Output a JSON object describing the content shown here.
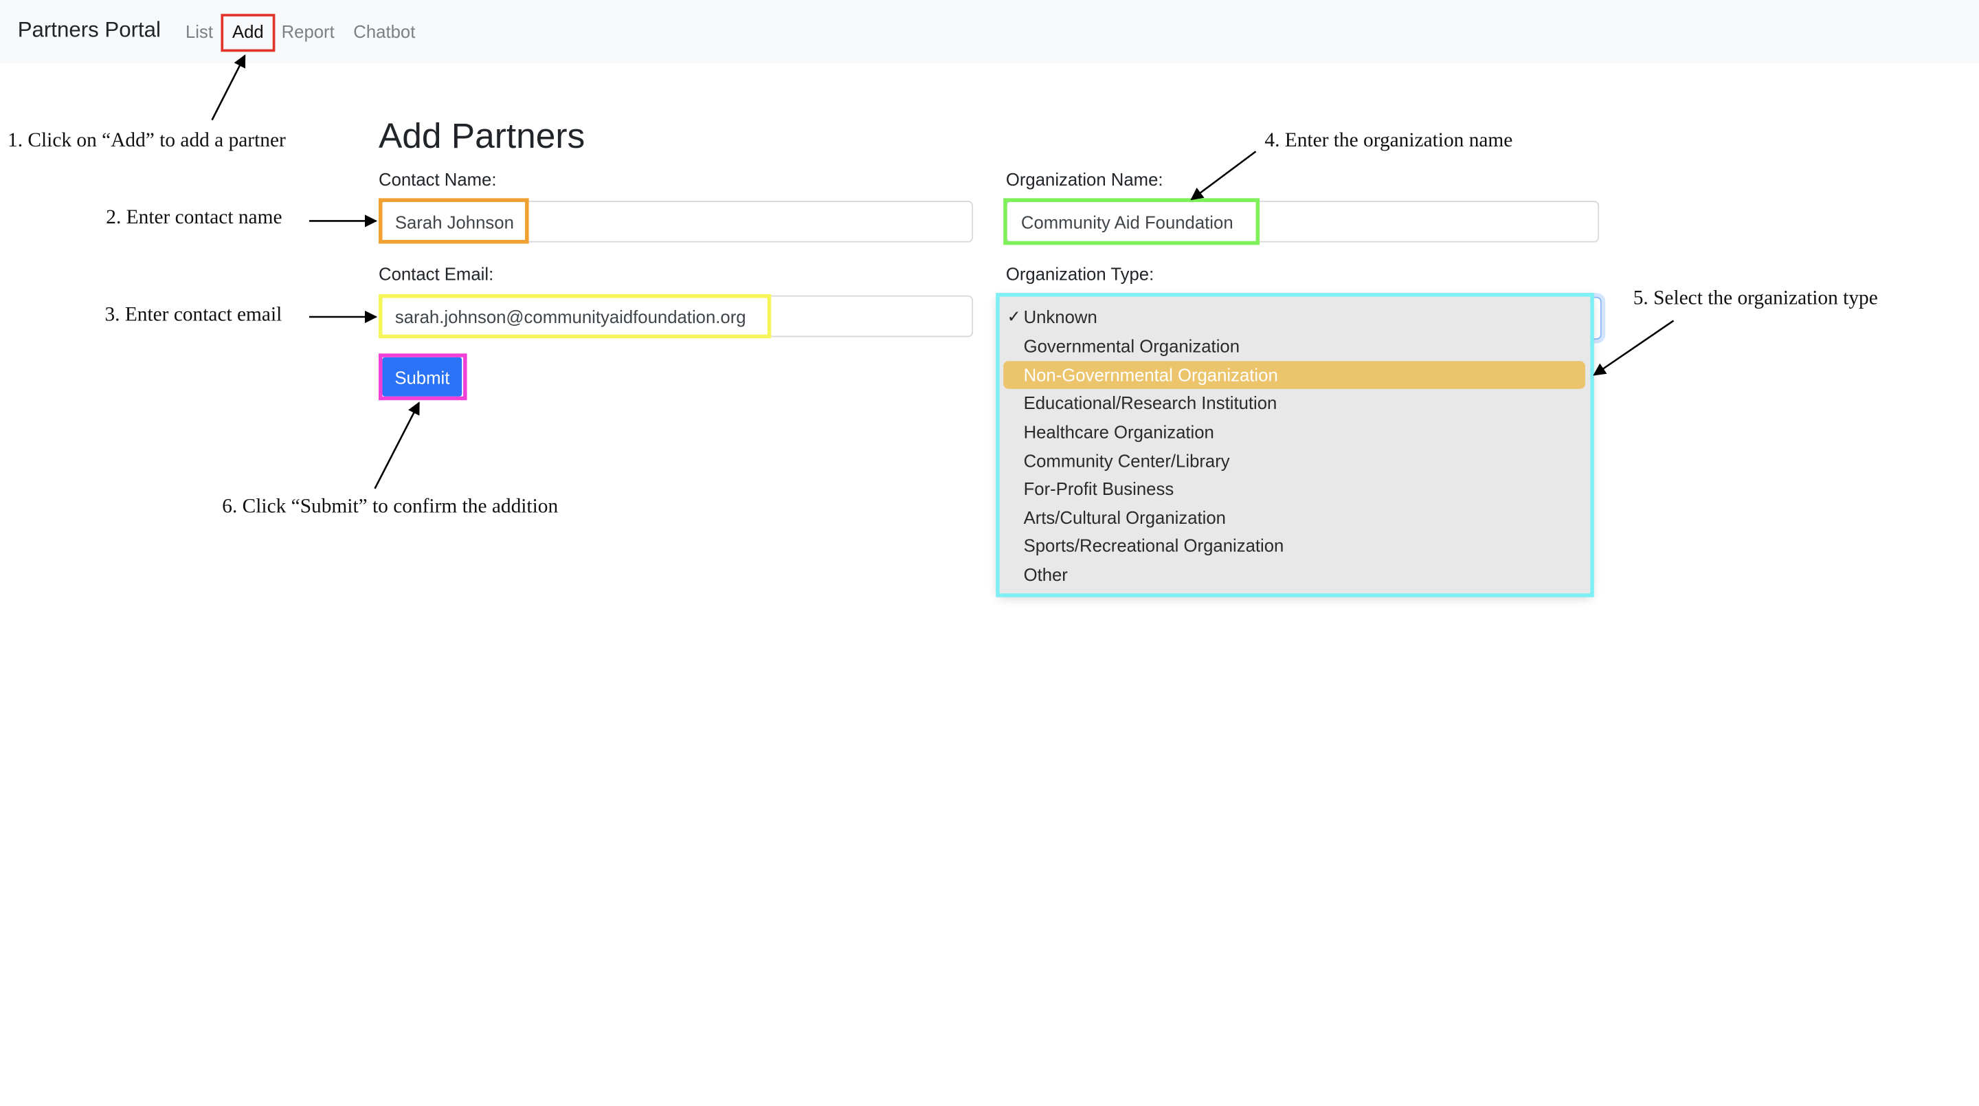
{
  "navbar": {
    "brand": "Partners Portal",
    "links": [
      {
        "label": "List"
      },
      {
        "label": "Add",
        "active": true
      },
      {
        "label": "Report"
      },
      {
        "label": "Chatbot"
      }
    ]
  },
  "form": {
    "title": "Add Partners",
    "contact_name": {
      "label": "Contact Name:",
      "value": "Sarah Johnson"
    },
    "contact_email": {
      "label": "Contact Email:",
      "value": "sarah.johnson@communityaidfoundation.org"
    },
    "organization_name": {
      "label": "Organization Name:",
      "value": "Community Aid Foundation"
    },
    "organization_type": {
      "label": "Organization Type:",
      "checked_option": "Unknown",
      "highlighted_option": "Non-Governmental Organization",
      "options": [
        "Unknown",
        "Governmental Organization",
        "Non-Governmental Organization",
        "Educational/Research Institution",
        "Healthcare Organization",
        "Community Center/Library",
        "For-Profit Business",
        "Arts/Cultural Organization",
        "Sports/Recreational Organization",
        "Other"
      ]
    },
    "submit_label": "Submit"
  },
  "annotations": {
    "step1": "1. Click on “Add” to add a partner",
    "step2": "2. Enter contact name",
    "step3": "3. Enter contact email",
    "step4": "4. Enter the organization name",
    "step5": "5. Select the organization type",
    "step6": "6. Click “Submit” to confirm the addition"
  },
  "colors": {
    "nav_bg": "#f8f9fa",
    "submit_bg": "#2b73f6",
    "highlight_option": "#ebc46b",
    "box_add": "#e0342a",
    "box_contact_name": "#f0a030",
    "box_contact_email": "#f5f55a",
    "box_org_name": "#7ef05a",
    "box_org_type": "#7ef0f5",
    "box_submit": "#f040d8"
  }
}
